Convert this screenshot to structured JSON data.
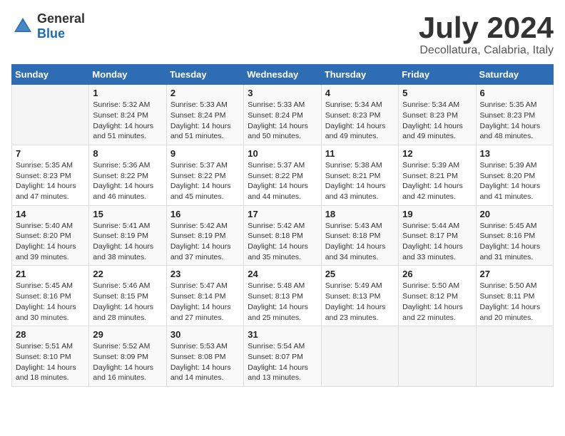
{
  "header": {
    "logo_general": "General",
    "logo_blue": "Blue",
    "title": "July 2024",
    "subtitle": "Decollatura, Calabria, Italy"
  },
  "weekdays": [
    "Sunday",
    "Monday",
    "Tuesday",
    "Wednesday",
    "Thursday",
    "Friday",
    "Saturday"
  ],
  "weeks": [
    [
      {
        "day": "",
        "info": ""
      },
      {
        "day": "1",
        "info": "Sunrise: 5:32 AM\nSunset: 8:24 PM\nDaylight: 14 hours\nand 51 minutes."
      },
      {
        "day": "2",
        "info": "Sunrise: 5:33 AM\nSunset: 8:24 PM\nDaylight: 14 hours\nand 51 minutes."
      },
      {
        "day": "3",
        "info": "Sunrise: 5:33 AM\nSunset: 8:24 PM\nDaylight: 14 hours\nand 50 minutes."
      },
      {
        "day": "4",
        "info": "Sunrise: 5:34 AM\nSunset: 8:23 PM\nDaylight: 14 hours\nand 49 minutes."
      },
      {
        "day": "5",
        "info": "Sunrise: 5:34 AM\nSunset: 8:23 PM\nDaylight: 14 hours\nand 49 minutes."
      },
      {
        "day": "6",
        "info": "Sunrise: 5:35 AM\nSunset: 8:23 PM\nDaylight: 14 hours\nand 48 minutes."
      }
    ],
    [
      {
        "day": "7",
        "info": "Sunrise: 5:35 AM\nSunset: 8:23 PM\nDaylight: 14 hours\nand 47 minutes."
      },
      {
        "day": "8",
        "info": "Sunrise: 5:36 AM\nSunset: 8:22 PM\nDaylight: 14 hours\nand 46 minutes."
      },
      {
        "day": "9",
        "info": "Sunrise: 5:37 AM\nSunset: 8:22 PM\nDaylight: 14 hours\nand 45 minutes."
      },
      {
        "day": "10",
        "info": "Sunrise: 5:37 AM\nSunset: 8:22 PM\nDaylight: 14 hours\nand 44 minutes."
      },
      {
        "day": "11",
        "info": "Sunrise: 5:38 AM\nSunset: 8:21 PM\nDaylight: 14 hours\nand 43 minutes."
      },
      {
        "day": "12",
        "info": "Sunrise: 5:39 AM\nSunset: 8:21 PM\nDaylight: 14 hours\nand 42 minutes."
      },
      {
        "day": "13",
        "info": "Sunrise: 5:39 AM\nSunset: 8:20 PM\nDaylight: 14 hours\nand 41 minutes."
      }
    ],
    [
      {
        "day": "14",
        "info": "Sunrise: 5:40 AM\nSunset: 8:20 PM\nDaylight: 14 hours\nand 39 minutes."
      },
      {
        "day": "15",
        "info": "Sunrise: 5:41 AM\nSunset: 8:19 PM\nDaylight: 14 hours\nand 38 minutes."
      },
      {
        "day": "16",
        "info": "Sunrise: 5:42 AM\nSunset: 8:19 PM\nDaylight: 14 hours\nand 37 minutes."
      },
      {
        "day": "17",
        "info": "Sunrise: 5:42 AM\nSunset: 8:18 PM\nDaylight: 14 hours\nand 35 minutes."
      },
      {
        "day": "18",
        "info": "Sunrise: 5:43 AM\nSunset: 8:18 PM\nDaylight: 14 hours\nand 34 minutes."
      },
      {
        "day": "19",
        "info": "Sunrise: 5:44 AM\nSunset: 8:17 PM\nDaylight: 14 hours\nand 33 minutes."
      },
      {
        "day": "20",
        "info": "Sunrise: 5:45 AM\nSunset: 8:16 PM\nDaylight: 14 hours\nand 31 minutes."
      }
    ],
    [
      {
        "day": "21",
        "info": "Sunrise: 5:45 AM\nSunset: 8:16 PM\nDaylight: 14 hours\nand 30 minutes."
      },
      {
        "day": "22",
        "info": "Sunrise: 5:46 AM\nSunset: 8:15 PM\nDaylight: 14 hours\nand 28 minutes."
      },
      {
        "day": "23",
        "info": "Sunrise: 5:47 AM\nSunset: 8:14 PM\nDaylight: 14 hours\nand 27 minutes."
      },
      {
        "day": "24",
        "info": "Sunrise: 5:48 AM\nSunset: 8:13 PM\nDaylight: 14 hours\nand 25 minutes."
      },
      {
        "day": "25",
        "info": "Sunrise: 5:49 AM\nSunset: 8:13 PM\nDaylight: 14 hours\nand 23 minutes."
      },
      {
        "day": "26",
        "info": "Sunrise: 5:50 AM\nSunset: 8:12 PM\nDaylight: 14 hours\nand 22 minutes."
      },
      {
        "day": "27",
        "info": "Sunrise: 5:50 AM\nSunset: 8:11 PM\nDaylight: 14 hours\nand 20 minutes."
      }
    ],
    [
      {
        "day": "28",
        "info": "Sunrise: 5:51 AM\nSunset: 8:10 PM\nDaylight: 14 hours\nand 18 minutes."
      },
      {
        "day": "29",
        "info": "Sunrise: 5:52 AM\nSunset: 8:09 PM\nDaylight: 14 hours\nand 16 minutes."
      },
      {
        "day": "30",
        "info": "Sunrise: 5:53 AM\nSunset: 8:08 PM\nDaylight: 14 hours\nand 14 minutes."
      },
      {
        "day": "31",
        "info": "Sunrise: 5:54 AM\nSunset: 8:07 PM\nDaylight: 14 hours\nand 13 minutes."
      },
      {
        "day": "",
        "info": ""
      },
      {
        "day": "",
        "info": ""
      },
      {
        "day": "",
        "info": ""
      }
    ]
  ]
}
